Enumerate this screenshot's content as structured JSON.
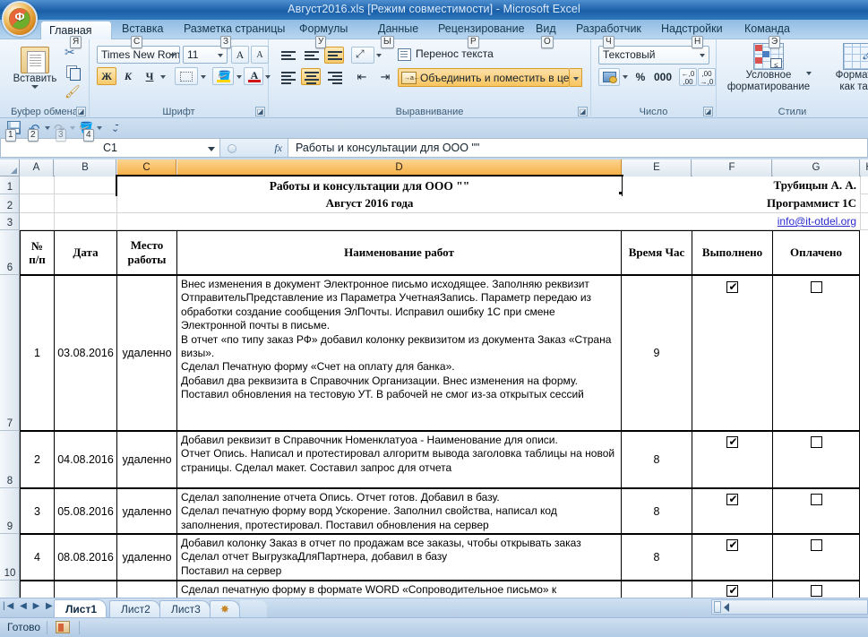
{
  "window": {
    "title": "Август2016.xls  [Режим совместимости]  -  Microsoft Excel",
    "office_button": "Ф"
  },
  "ribbon": {
    "tabs": [
      {
        "label": "Главная",
        "keytip": "Я",
        "active": true
      },
      {
        "label": "Вставка",
        "keytip": "С",
        "active": false
      },
      {
        "label": "Разметка страницы",
        "keytip": "З",
        "active": false
      },
      {
        "label": "Формулы",
        "keytip": "У",
        "active": false
      },
      {
        "label": "Данные",
        "keytip": "Ы",
        "active": false
      },
      {
        "label": "Рецензирование",
        "keytip": "Р",
        "active": false
      },
      {
        "label": "Вид",
        "keytip": "О",
        "active": false
      },
      {
        "label": "Разработчик",
        "keytip": "Ч",
        "active": false
      },
      {
        "label": "Надстройки",
        "keytip": "Н",
        "active": false
      },
      {
        "label": "Команда",
        "keytip": "Э",
        "active": false
      }
    ],
    "groups": {
      "clipboard": {
        "title": "Буфер обмена",
        "paste_label": "Вставить",
        "cut_icon": "scissors-icon",
        "copy_icon": "copy-icon",
        "format_painter_icon": "format-painter-icon"
      },
      "font": {
        "title": "Шрифт",
        "font_name": "Times New Rom",
        "font_size": "11",
        "grow_font": "A",
        "shrink_font": "A",
        "bold": "Ж",
        "italic": "К",
        "underline": "Ч",
        "borders_icon": "borders-icon",
        "fill_color_icon": "fill-color-icon",
        "font_color_icon": "font-color-icon"
      },
      "alignment": {
        "title": "Выравнивание",
        "wrap_text": "Перенос текста",
        "merge_center": "Объединить и поместить в центре",
        "orientation_icon": "text-orientation-icon",
        "indent_decrease_icon": "decrease-indent-icon",
        "indent_increase_icon": "increase-indent-icon"
      },
      "number": {
        "title": "Число",
        "format": "Текстовый",
        "accounting_icon": "accounting-format-icon",
        "percent": "%",
        "thousands": "000",
        "decrease_decimal_icon": "decrease-decimal-icon",
        "increase_decimal_icon": "increase-decimal-icon"
      },
      "styles": {
        "title": "Стили",
        "conditional_formatting": "Условное\nформатирование",
        "format_as_table": "Форматир\nкак табл"
      }
    }
  },
  "quick_access": {
    "save_icon": "save-icon",
    "undo_icon": "undo-icon",
    "redo_icon": "redo-icon",
    "fill_icon": "fill-icon",
    "customize_icon": "customize-qat-icon",
    "keytips": [
      "1",
      "2",
      "3",
      "4"
    ]
  },
  "formula_bar": {
    "name_box": "C1",
    "fx_label": "fx",
    "content": "Работы и консультации для ООО \"\""
  },
  "grid": {
    "columns": [
      "A",
      "B",
      "C",
      "D",
      "E",
      "F",
      "G",
      "H"
    ],
    "selected_column": "D",
    "row_numbers": [
      "1",
      "2",
      "3",
      "6",
      "7",
      "8",
      "9",
      "10"
    ],
    "header_block": {
      "title": "Работы и консультации для ООО \"\"",
      "subtitle": "Август 2016 года",
      "person": "Трубицын А. А.",
      "role": "Программист 1С",
      "email": "info@it-otdel.org"
    },
    "table_headers": [
      "№\nп/п",
      "Дата",
      "Место\nработы",
      "Наименование работ",
      "Время Час",
      "Выполнено",
      "Оплачено"
    ],
    "rows": [
      {
        "num": "1",
        "date": "03.08.2016",
        "place": "удаленно",
        "work": "Внес изменения в документ Электронное письмо исходящее. Заполняю реквизит ОтправительПредставление из Параметра УчетнаяЗапись. Параметр передаю из обработки создание сообщения ЭлПочты. Исправил ошибку 1С при смене Электронной почты в письме.\nВ отчет «по типу заказ РФ» добавил колонку реквизитом из документа Заказ «Страна визы».\nСделал Печатную форму  «Счет на оплату для банка».\nДобавил два реквизита в Справочник Организации. Внес изменения на форму.\nПоставил обновления на тестовую УТ. В рабочей не смог из-за открытых сессий",
        "hours": "9",
        "done": true,
        "paid": false
      },
      {
        "num": "2",
        "date": "04.08.2016",
        "place": "удаленно",
        "work": "Добавил реквизит в Справочник Номенклатуоа - Наименование для описи.\nОтчет Опись. Написал и протестировал алгоритм вывода заголовка таблицы на новой страницы. Сделал макет. Составил запрос для отчета",
        "hours": "8",
        "done": true,
        "paid": false
      },
      {
        "num": "3",
        "date": "05.08.2016",
        "place": "удаленно",
        "work": "Сделал заполнение отчета Опись. Отчет готов. Добавил в базу.\nСделал печатную форму ворд Ускорение. Заполнил свойства, написал код заполнения, протестировал.  Поставил обновления на сервер",
        "hours": "8",
        "done": true,
        "paid": false
      },
      {
        "num": "4",
        "date": "08.08.2016",
        "place": "удаленно",
        "work": "Добавил колонку Заказ в отчет по продажам все заказы, чтобы открывать заказ\nСделал отчет ВыгрузкаДляПартнера, добавил в базу\nПоставил на сервер",
        "hours": "8",
        "done": true,
        "paid": false
      },
      {
        "num": "",
        "date": "",
        "place": "",
        "work": "Сделал печатную форму в формате WORD «Сопроводительное письмо» к",
        "hours": "",
        "done": true,
        "paid": false
      }
    ]
  },
  "sheet_tabs": {
    "tabs": [
      "Лист1",
      "Лист2",
      "Лист3"
    ],
    "active": "Лист1",
    "new_sheet_icon": "new-sheet-icon",
    "nav_first": "|◀",
    "nav_prev": "◀",
    "nav_next": "▶",
    "nav_last": "▶|"
  },
  "status_bar": {
    "state": "Готово",
    "view_icon": "page-view-icon"
  },
  "colors": {
    "accent": "#f5ad3e",
    "title_bg": "#1a5fa8",
    "link": "#2a2ad0"
  }
}
